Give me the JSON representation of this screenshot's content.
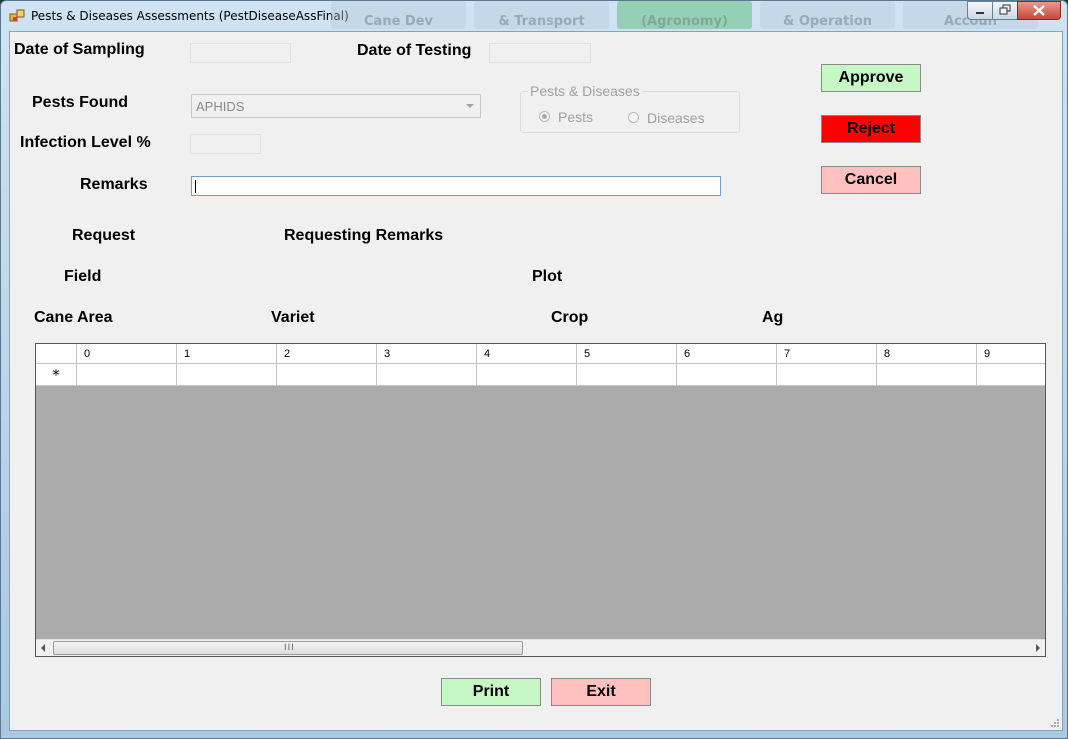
{
  "window": {
    "title": "Pests & Diseases  Assessments (PestDiseaseAssFinal)",
    "background_tabs": [
      "Cane Dev",
      "& Transport",
      "(Agronomy)",
      "& Operation",
      "Accoun"
    ]
  },
  "form": {
    "date_of_sampling_label": "Date of Sampling",
    "date_of_sampling_value": "",
    "date_of_testing_label": "Date of Testing",
    "date_of_testing_value": "",
    "pests_found_label": "Pests Found",
    "pests_found_value": "APHIDS",
    "infection_level_label": "Infection Level %",
    "infection_level_value": "",
    "remarks_label": "Remarks",
    "remarks_value": "",
    "group_title": "Pests & Diseases",
    "radio_pests": "Pests",
    "radio_diseases": "Diseases",
    "radio_selected": "Pests"
  },
  "info": {
    "request_label": "Request",
    "requesting_remarks_label": "Requesting Remarks",
    "field_label": "Field",
    "plot_label": "Plot",
    "cane_area_label": "Cane Area",
    "variet_label": "Variet",
    "crop_label": "Crop",
    "ag_label": "Ag"
  },
  "actions": {
    "approve": "Approve",
    "reject": "Reject",
    "cancel": "Cancel",
    "print": "Print",
    "exit": "Exit"
  },
  "grid": {
    "columns": [
      "0",
      "1",
      "2",
      "3",
      "4",
      "5",
      "6",
      "7",
      "8",
      "9"
    ],
    "new_row_marker": "*",
    "scroll_grip": "III"
  },
  "colors": {
    "approve_bg": "#c6f8c6",
    "reject_bg": "#ff0000",
    "cancel_bg": "#ffc0c0",
    "grid_empty_bg": "#ababab"
  }
}
